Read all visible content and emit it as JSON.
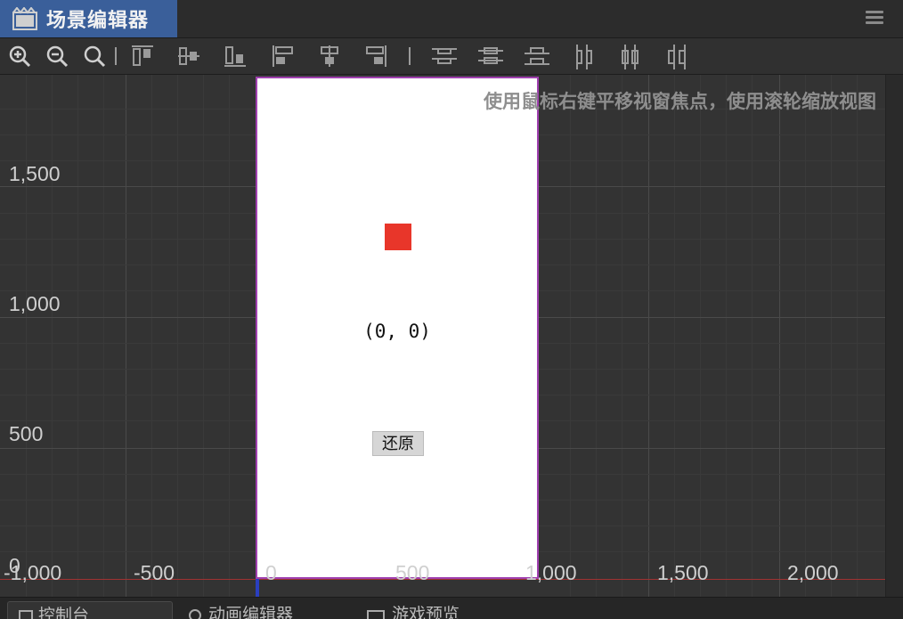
{
  "title_tab": {
    "label": "场景编辑器",
    "icon": "scene-editor-icon"
  },
  "toolbar": {
    "buttons": [
      {
        "name": "zoom-in-button",
        "icon": "zoom-in-icon"
      },
      {
        "name": "zoom-out-button",
        "icon": "zoom-out-icon"
      },
      {
        "name": "zoom-reset-button",
        "icon": "zoom-reset-icon"
      },
      {
        "name": "align-top-button",
        "icon": "align-top-icon"
      },
      {
        "name": "align-vcenter-button",
        "icon": "align-vcenter-icon"
      },
      {
        "name": "align-bottom-button",
        "icon": "align-bottom-icon"
      },
      {
        "name": "align-left-button",
        "icon": "align-left-icon"
      },
      {
        "name": "align-hcenter-button",
        "icon": "align-hcenter-icon"
      },
      {
        "name": "align-right-button",
        "icon": "align-right-icon"
      },
      {
        "name": "distribute-top-button",
        "icon": "distribute-top-icon"
      },
      {
        "name": "distribute-vcenter-button",
        "icon": "distribute-vcenter-icon"
      },
      {
        "name": "distribute-bottom-button",
        "icon": "distribute-bottom-icon"
      },
      {
        "name": "distribute-left-button",
        "icon": "distribute-left-icon"
      },
      {
        "name": "distribute-hcenter-button",
        "icon": "distribute-hcenter-icon"
      },
      {
        "name": "distribute-right-button",
        "icon": "distribute-right-icon"
      }
    ]
  },
  "viewport": {
    "hint": "使用鼠标右键平移视窗焦点，使用滚轮缩放视图",
    "y_axis_labels": [
      "1,500",
      "1,000",
      "500",
      "0"
    ],
    "x_axis_labels": [
      "-1,000",
      "-500",
      "0",
      "500",
      "1,000",
      "1,500",
      "2,000"
    ]
  },
  "canvas": {
    "coord_text": "(0, 0)",
    "restore_button": "还原",
    "sprite_color": "#e8362a"
  },
  "bottom_tabs": [
    {
      "label": "控制台",
      "icon": "console-icon"
    },
    {
      "label": "动画编辑器",
      "icon": "animation-icon"
    },
    {
      "label": "游戏预览",
      "icon": "preview-icon"
    }
  ],
  "colors": {
    "accent": "#3a5f9a",
    "canvas_border": "#a040b0",
    "background": "#333333"
  }
}
